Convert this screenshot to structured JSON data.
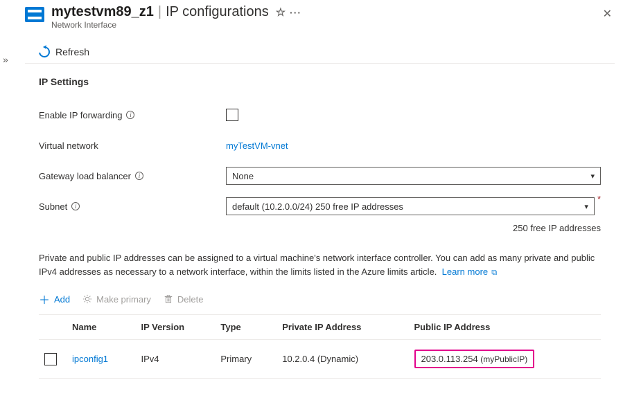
{
  "header": {
    "resource_name": "mytestvm89_z1",
    "page_title": "IP configurations",
    "subtitle": "Network Interface"
  },
  "toolbar": {
    "refresh": "Refresh"
  },
  "section": {
    "title": "IP Settings"
  },
  "form": {
    "ip_forwarding_label": "Enable IP forwarding",
    "vnet_label": "Virtual network",
    "vnet_value": "myTestVM-vnet",
    "glb_label": "Gateway load balancer",
    "glb_value": "None",
    "subnet_label": "Subnet",
    "subnet_value": "default (10.2.0.0/24) 250 free IP addresses",
    "subnet_hint": "250 free IP addresses"
  },
  "description": {
    "text": "Private and public IP addresses can be assigned to a virtual machine's network interface controller. You can add as many private and public IPv4 addresses as necessary to a network interface, within the limits listed in the Azure limits article.",
    "learn_more": "Learn more"
  },
  "actions": {
    "add": "Add",
    "make_primary": "Make primary",
    "delete": "Delete"
  },
  "table": {
    "headers": {
      "name": "Name",
      "ip_version": "IP Version",
      "type": "Type",
      "private_ip": "Private IP Address",
      "public_ip": "Public IP Address"
    },
    "rows": [
      {
        "name": "ipconfig1",
        "ip_version": "IPv4",
        "type": "Primary",
        "private_ip": "10.2.0.4 (Dynamic)",
        "public_ip": "203.0.113.254",
        "public_ip_name": "(myPublicIP)"
      }
    ]
  }
}
